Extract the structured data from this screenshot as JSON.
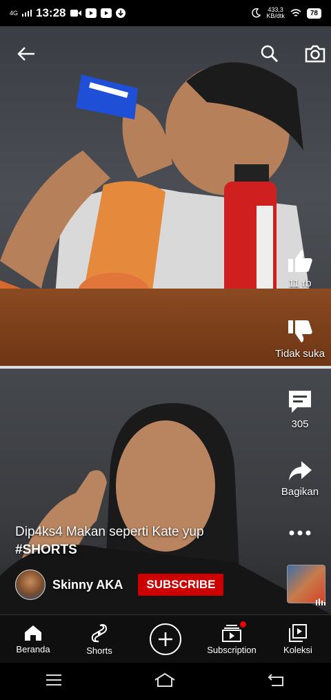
{
  "status_bar": {
    "network": "4G",
    "time": "13:28",
    "speed_value": "433,3",
    "speed_unit": "KB/dtk",
    "battery": "78"
  },
  "reel": {
    "like_count": "11 rb",
    "dislike_label": "Tidak suka",
    "comment_count": "305",
    "share_label": "Bagikan",
    "caption": "Dip4ks4 Makan seperti Kate yup",
    "hashtag": "#SHORTS",
    "channel_name": "Skinny AKA",
    "subscribe_label": "SUBSCRIBE"
  },
  "bottom_nav": {
    "items": [
      {
        "label": "Beranda",
        "icon": "home-icon"
      },
      {
        "label": "Shorts",
        "icon": "shorts-icon"
      },
      {
        "label": "",
        "icon": "create-icon"
      },
      {
        "label": "Subscription",
        "icon": "subscriptions-icon"
      },
      {
        "label": "Koleksi",
        "icon": "library-icon"
      }
    ]
  },
  "colors": {
    "subscribe": "#cc0000",
    "nav_background": "#0f0f0f"
  }
}
